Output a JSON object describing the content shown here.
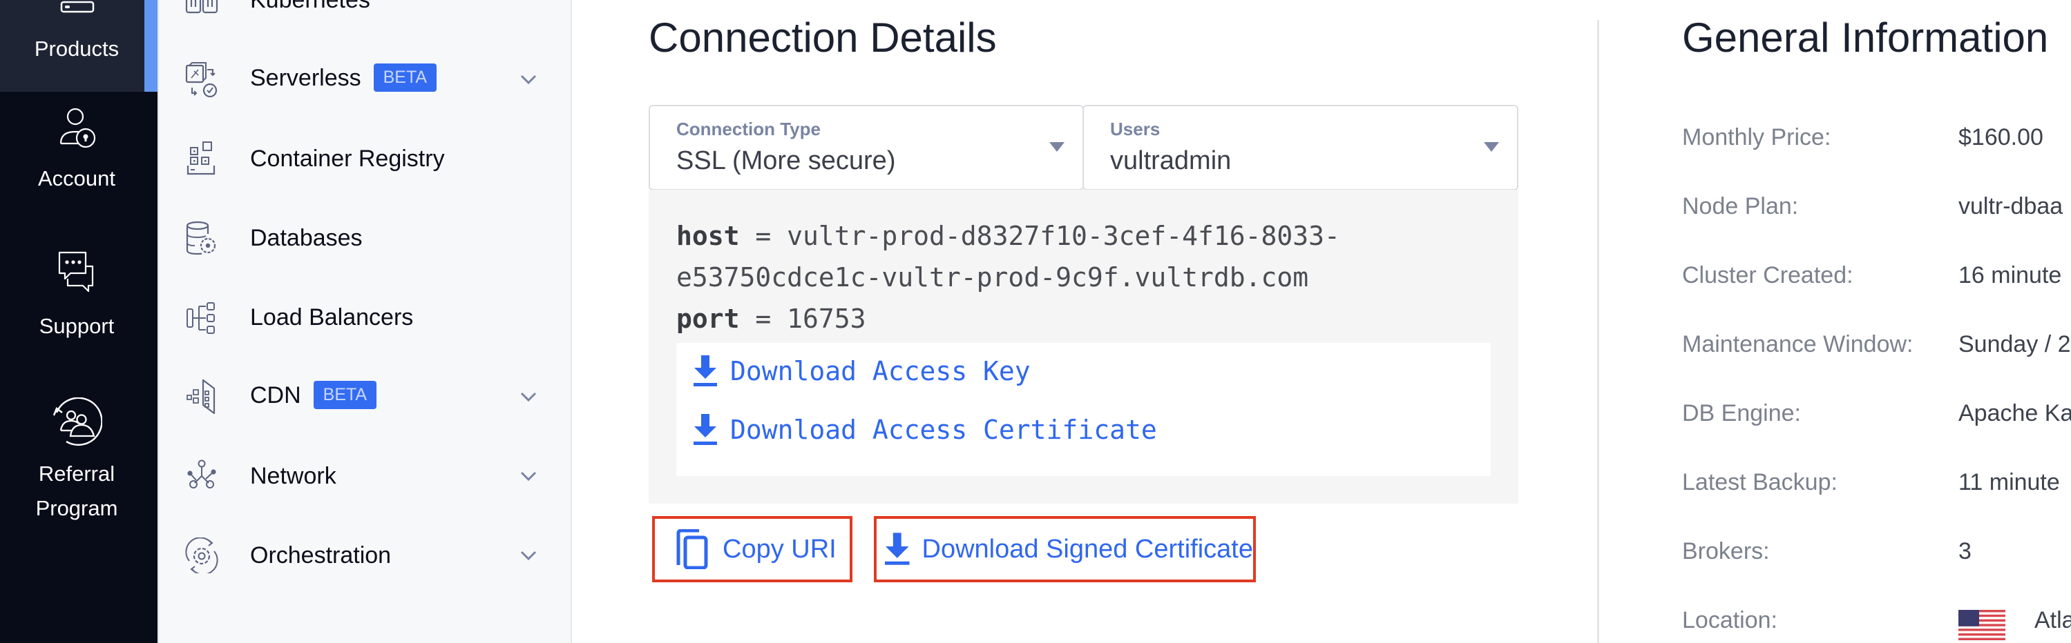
{
  "rail": {
    "items": [
      {
        "label": "Products",
        "icon": "server-icon",
        "active": true
      },
      {
        "label": "Account",
        "icon": "user-lock-icon"
      },
      {
        "label": "Support",
        "icon": "chat-bubbles-icon"
      },
      {
        "label_line1": "Referral",
        "label_line2": "Program",
        "icon": "referral-icon"
      }
    ],
    "active_color": "#6197f2"
  },
  "sidebar": {
    "items": [
      {
        "label": "Kubernetes",
        "icon": "kubernetes-icon"
      },
      {
        "label": "Serverless",
        "badge": "BETA",
        "icon": "serverless-icon",
        "expandable": true
      },
      {
        "label": "Container Registry",
        "icon": "container-registry-icon"
      },
      {
        "label": "Databases",
        "icon": "database-icon"
      },
      {
        "label": "Load Balancers",
        "icon": "load-balancer-icon"
      },
      {
        "label": "CDN",
        "badge": "BETA",
        "icon": "cdn-icon",
        "expandable": true
      },
      {
        "label": "Network",
        "icon": "network-icon",
        "expandable": true
      },
      {
        "label": "Orchestration",
        "icon": "orchestration-icon",
        "expandable": true
      }
    ],
    "badge_color": "#336cf0"
  },
  "connection": {
    "title": "Connection Details",
    "connection_type": {
      "label": "Connection Type",
      "value": "SSL (More secure)"
    },
    "users": {
      "label": "Users",
      "value": "vultradmin"
    },
    "host_key": "host",
    "host_value_line1": " = vultr-prod-d8327f10-3cef-4f16-8033-",
    "host_value_line2": "e53750cdce1c-vultr-prod-9c9f.vultrdb.com",
    "port_key": "port",
    "port_value": " = 16753",
    "download_access_key": "Download Access Key",
    "download_access_certificate": "Download Access Certificate",
    "copy_uri": "Copy URI",
    "download_signed_certificate": "Download Signed Certificate",
    "link_color": "#2f67ee",
    "highlight_color": "#e03a22"
  },
  "general": {
    "title": "General Information",
    "rows": [
      {
        "label": "Monthly Price:",
        "value": "$160.00"
      },
      {
        "label": "Node Plan:",
        "value": "vultr-dbaa"
      },
      {
        "label": "Cluster Created:",
        "value": "16 minute"
      },
      {
        "label": "Maintenance Window:",
        "value": "Sunday / 2"
      },
      {
        "label": "DB Engine:",
        "value": "Apache Ka"
      },
      {
        "label": "Latest Backup:",
        "value": "11 minute"
      },
      {
        "label": "Brokers:",
        "value": "3"
      },
      {
        "label": "Location:",
        "value": "Atla",
        "flag": "us-flag-icon"
      }
    ]
  }
}
